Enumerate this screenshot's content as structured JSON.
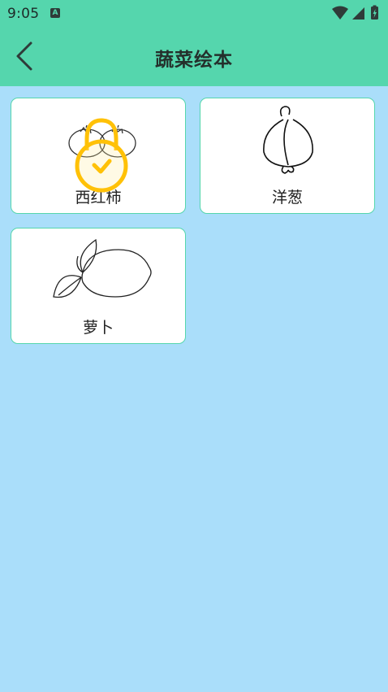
{
  "status_bar": {
    "time": "9:05",
    "notification_icon": "text-a-icon",
    "icons": [
      "wifi-icon",
      "signal-icon",
      "battery-charging-icon"
    ]
  },
  "header": {
    "title": "蔬菜绘本",
    "back_icon": "chevron-left-icon"
  },
  "colors": {
    "header_bg": "#55d6ad",
    "page_bg": "#aadefa",
    "card_border": "#55d6ad",
    "lock_color": "#ffc107"
  },
  "cards": [
    {
      "label": "西红柿",
      "image": "tomato-drawing",
      "locked": true,
      "lock_icon": "lock-checked-icon"
    },
    {
      "label": "洋葱",
      "image": "onion-drawing",
      "locked": false
    },
    {
      "label": "萝卜",
      "image": "lemon-drawing",
      "locked": false
    }
  ]
}
